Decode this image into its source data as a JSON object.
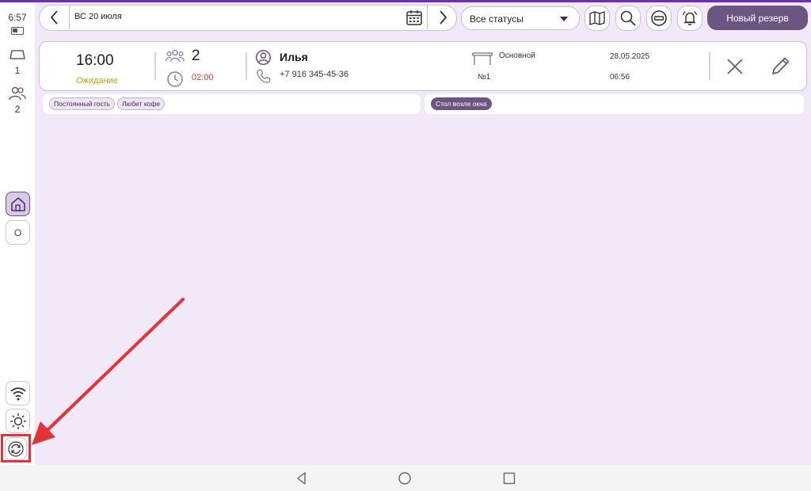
{
  "status_bar": {
    "time": "6:57"
  },
  "sidebar": {
    "tables_count": "1",
    "guests_count": "2",
    "mode_button_label": "O"
  },
  "header": {
    "date": "ВС 20 июля",
    "status_filter": "Все статусы",
    "new_reservation_label": "Новый резерв"
  },
  "reservation": {
    "time": "16:00",
    "status": "Ожидание",
    "guests": "2",
    "duration": "02:00",
    "name": "Илья",
    "phone": "+7 916 345-45-36",
    "hall": "Основной",
    "table": "№1",
    "created_date": "28.05.2025",
    "created_time": "06:56",
    "guest_tags": [
      "Постоянный гость",
      "Любит кофе"
    ],
    "table_tags": [
      "Стол возле окна"
    ]
  },
  "colors": {
    "accent": "#6c5580",
    "background": "#f1e8f8",
    "status_waiting": "#c99a10",
    "duration": "#d23a3a",
    "highlight": "#e53238"
  }
}
